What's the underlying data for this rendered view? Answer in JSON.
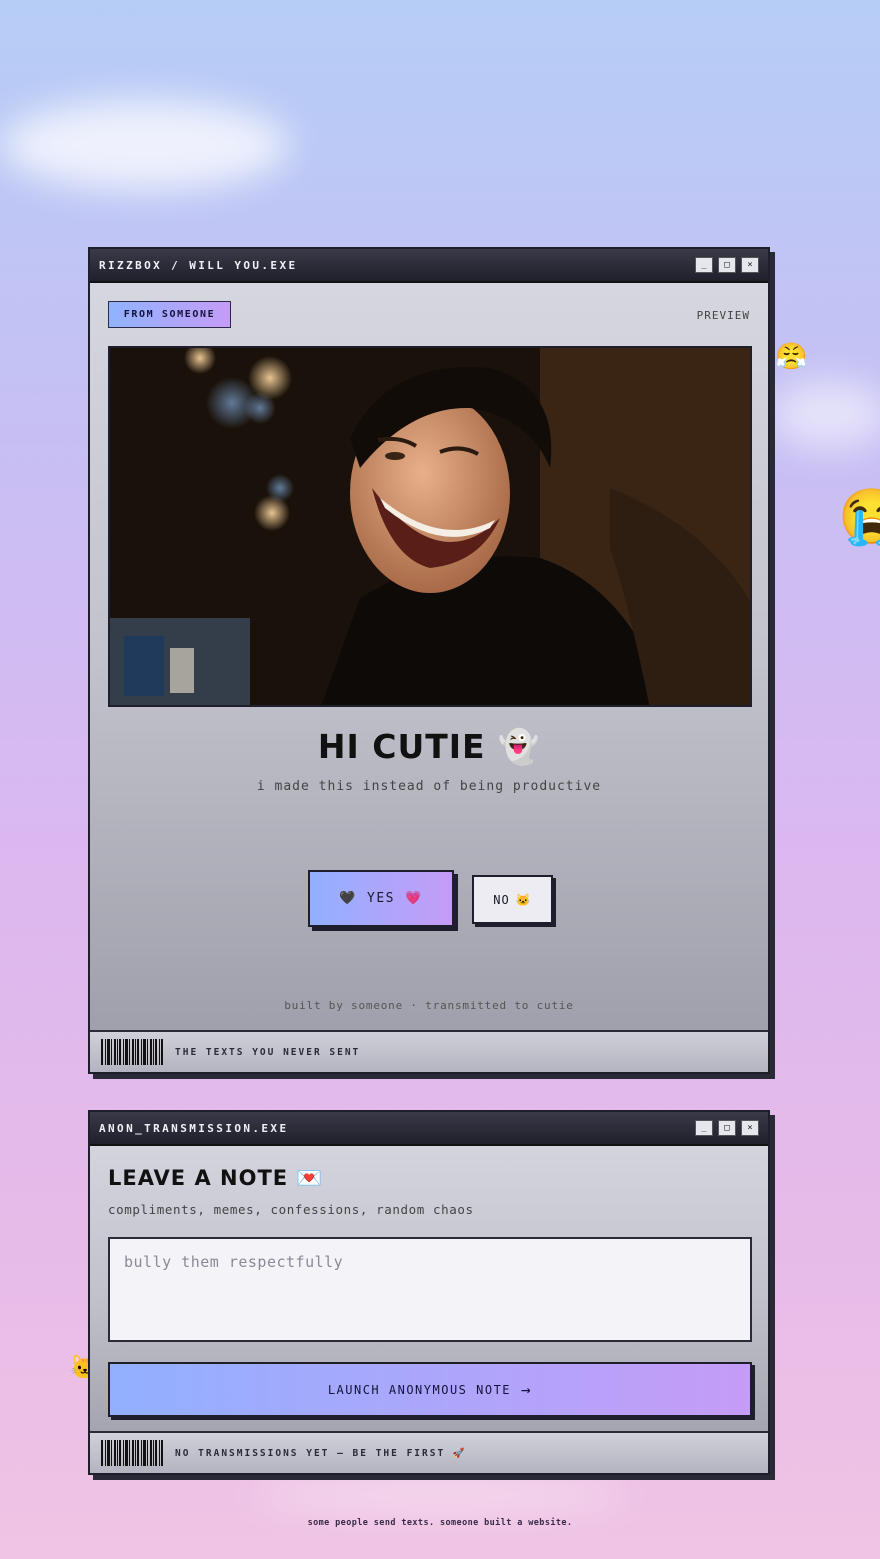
{
  "window1": {
    "title": "RIZZBOX / WILL YOU.EXE",
    "controls": [
      "_",
      "□",
      "×"
    ],
    "badge": "FROM SOMEONE",
    "preview_label": "PREVIEW",
    "headline": "HI CUTIE 👻",
    "subline": "i made this instead of being productive",
    "yes": {
      "icon": "🖤",
      "label": "YES",
      "emoji": "💗"
    },
    "no": {
      "label": "NO",
      "emoji": "🐱"
    },
    "credits": "built by someone · transmitted to cutie",
    "status": "THE TEXTS YOU NEVER SENT"
  },
  "window2": {
    "title": "ANON_TRANSMISSION.EXE",
    "controls": [
      "_",
      "□",
      "×"
    ],
    "heading": "LEAVE A NOTE 💌",
    "subheading": "compliments, memes, confessions, random chaos",
    "textarea_placeholder": "bully them respectfully",
    "launch_label": "LAUNCH ANONYMOUS NOTE",
    "launch_arrow": "→",
    "status": "NO TRANSMISSIONS YET — BE THE FIRST 🚀"
  },
  "floaters": [
    "😤",
    "😭",
    "🐱"
  ],
  "footer": "some people send texts. someone built a website.",
  "colors": {
    "accent_start": "#92b0ff",
    "accent_end": "#c59cf7",
    "titlebar": "#20202c"
  }
}
